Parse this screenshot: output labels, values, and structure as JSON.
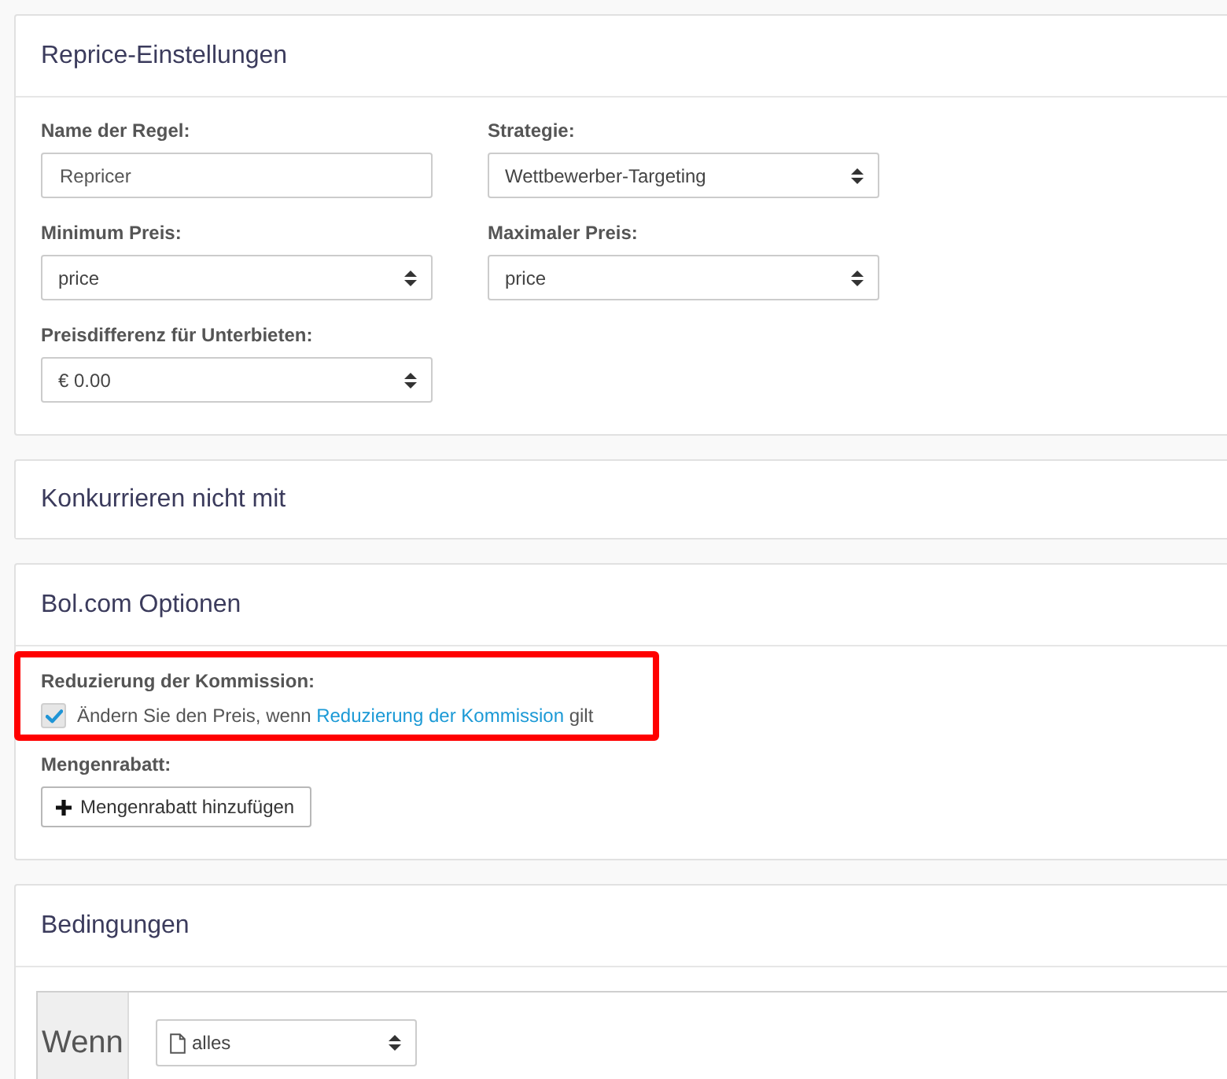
{
  "panels": [
    {
      "kind": "settings",
      "title": "Reprice-Einstellungen",
      "fields": [
        {
          "kind": "text",
          "label": "Name der Regel:",
          "value": "Repricer"
        },
        {
          "kind": "select",
          "label": "Strategie:",
          "value": "Wettbewerber-Targeting"
        },
        {
          "kind": "select",
          "label": "Minimum Preis:",
          "value": "price"
        },
        {
          "kind": "select",
          "label": "Maximaler Preis:",
          "value": "price"
        },
        {
          "kind": "select",
          "label": "Preisdifferenz für Unterbieten:",
          "value": "€ 0.00"
        }
      ]
    },
    {
      "kind": "collapsed",
      "title": "Konkurrieren nicht mit"
    },
    {
      "kind": "options",
      "title": "Bol.com Optionen",
      "commission": {
        "label": "Reduzierung der Kommission:",
        "highlighted": true,
        "checked": true,
        "text": "Ändern Sie den Preis, wenn",
        "link": "Reduzierung der Kommission",
        "text_end": "gilt"
      },
      "discount": {
        "label": "Mengenrabatt:",
        "button": "Mengenrabatt hinzufügen"
      }
    },
    {
      "kind": "conditions",
      "title": "Bedingungen",
      "condition": {
        "keyword": "Wenn",
        "value": "alles"
      }
    }
  ]
}
